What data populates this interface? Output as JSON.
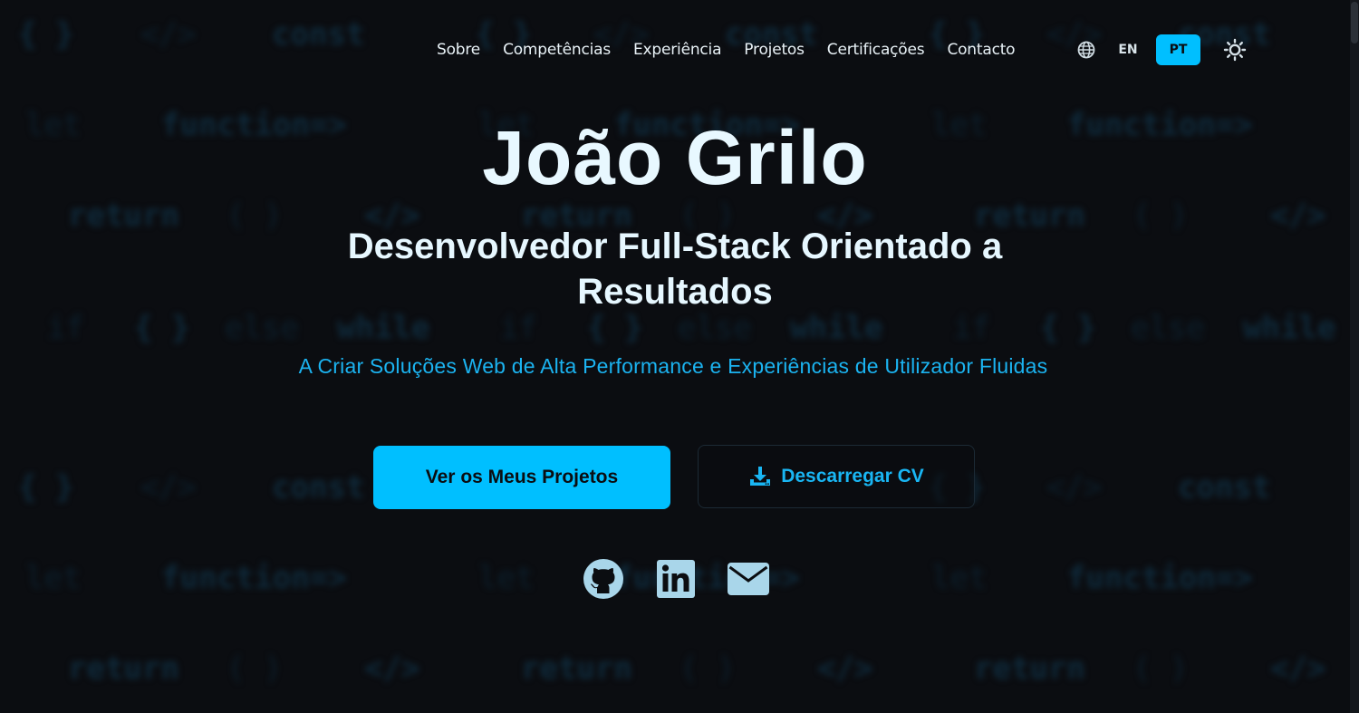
{
  "nav": {
    "items": [
      {
        "label": "Sobre"
      },
      {
        "label": "Competências"
      },
      {
        "label": "Experiência"
      },
      {
        "label": "Projetos"
      },
      {
        "label": "Certificações"
      },
      {
        "label": "Contacto"
      }
    ],
    "language_icon": "globe-icon",
    "languages": [
      {
        "label": "EN",
        "active": false
      },
      {
        "label": "PT",
        "active": true
      }
    ],
    "theme_icon": "sun-icon"
  },
  "hero": {
    "name": "João Grilo",
    "title": "Desenvolvedor Full-Stack Orientado a Resultados",
    "subtitle": "A Criar Soluções Web de Alta Performance e Experiências de Utilizador Fluidas",
    "primary_button": "Ver os Meus Projetos",
    "secondary_button": "Descarregar CV",
    "secondary_icon": "download-icon"
  },
  "socials": [
    {
      "name": "GitHub",
      "icon": "github-icon"
    },
    {
      "name": "LinkedIn",
      "icon": "linkedin-icon"
    },
    {
      "name": "Email",
      "icon": "mail-icon"
    }
  ],
  "colors": {
    "background": "#0b0d11",
    "accent": "#00bfff",
    "heading": "#e8f8ff",
    "subtitle": "#1bb3f0",
    "icon": "#a9d6ea"
  }
}
